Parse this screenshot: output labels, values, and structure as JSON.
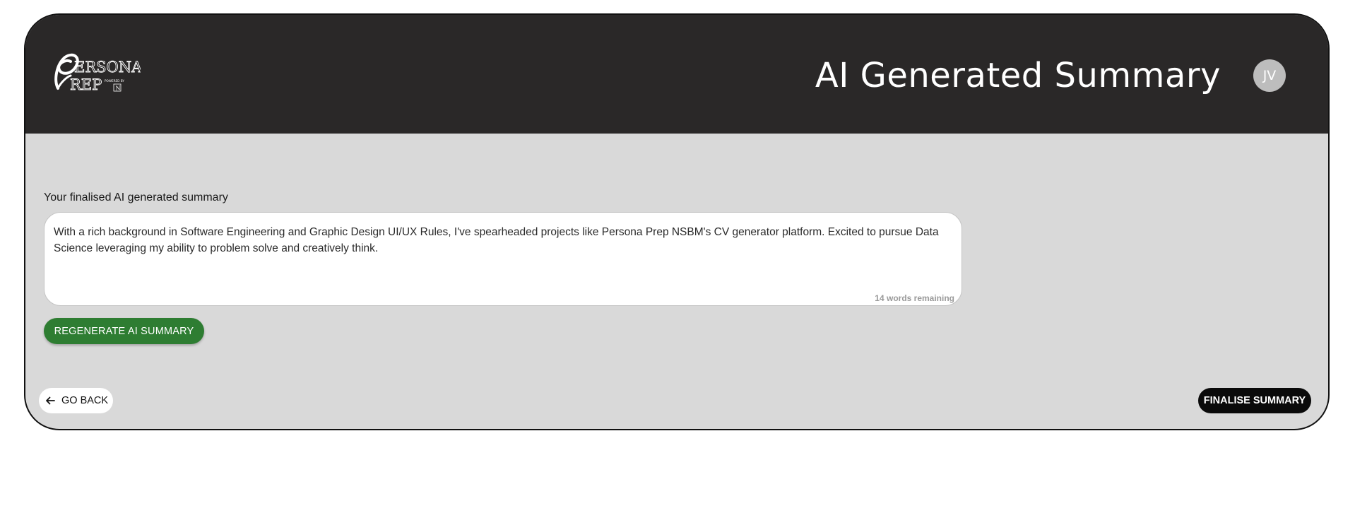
{
  "header": {
    "logo": {
      "text_line1": "ERSONA",
      "text_line2": "REP",
      "powered_by": "POWERED BY",
      "partner_mark": "N",
      "icon": "persona-prep-logo"
    },
    "title": "AI Generated Summary",
    "avatar_initials": "JV",
    "colors": {
      "header_bg": "#2a2828",
      "avatar_bg": "#bdbdbd"
    }
  },
  "summary": {
    "label": "Your finalised AI generated summary",
    "text": "With a rich background in Software Engineering and Graphic Design UI/UX Rules, I've spearheaded projects like Persona Prep NSBM's CV generator platform. Excited to pursue Data Science leveraging my ability to problem solve and creatively think.",
    "words_remaining": "14 words remaining"
  },
  "actions": {
    "regenerate_label": "REGENERATE AI SUMMARY",
    "back_label": "GO BACK",
    "back_icon": "arrow-left-icon",
    "finalise_label": "FINALISE SUMMARY",
    "colors": {
      "regenerate_bg": "#2e7d32",
      "finalise_bg": "#0a0a0a",
      "page_bg": "#d9d9d9"
    }
  }
}
